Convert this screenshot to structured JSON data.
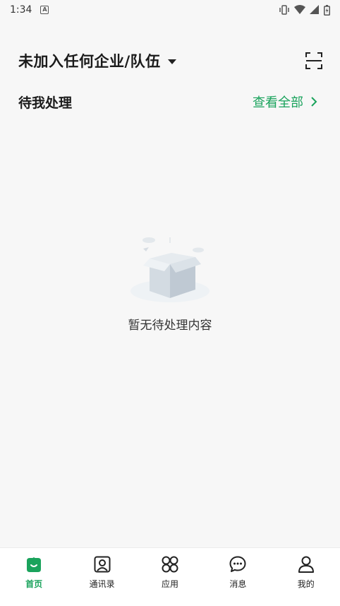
{
  "status_bar": {
    "time": "1:34",
    "notification_icon": "A"
  },
  "header": {
    "org_title": "未加入任何企业/队伍",
    "scan_icon": "scan-icon"
  },
  "section": {
    "title": "待我处理",
    "view_all": "查看全部"
  },
  "empty_state": {
    "text": "暂无待处理内容",
    "illustration": "empty-box-illustration"
  },
  "tabbar": {
    "tabs": [
      {
        "label": "首页",
        "icon": "home-icon",
        "active": true
      },
      {
        "label": "通讯录",
        "icon": "contacts-icon",
        "active": false
      },
      {
        "label": "应用",
        "icon": "apps-icon",
        "active": false
      },
      {
        "label": "消息",
        "icon": "message-icon",
        "active": false
      },
      {
        "label": "我的",
        "icon": "profile-icon",
        "active": false
      }
    ]
  },
  "colors": {
    "accent": "#1aa35c",
    "background": "#f7f7f7"
  }
}
